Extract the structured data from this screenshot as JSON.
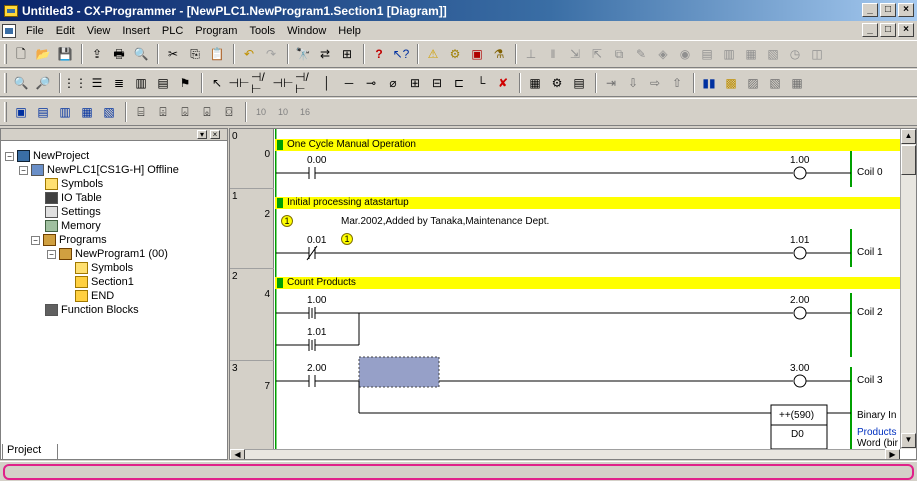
{
  "title": "Untitled3 - CX-Programmer - [NewPLC1.NewProgram1.Section1 [Diagram]]",
  "window_buttons": {
    "minimize": "_",
    "maximize": "□",
    "close": "×"
  },
  "menu": [
    "File",
    "Edit",
    "View",
    "Insert",
    "PLC",
    "Program",
    "Tools",
    "Window",
    "Help"
  ],
  "tree": {
    "project": "NewProject",
    "plc": "NewPLC1[CS1G-H] Offline",
    "symbols": "Symbols",
    "io_table": "IO Table",
    "settings": "Settings",
    "memory": "Memory",
    "programs": "Programs",
    "program1": "NewProgram1 (00)",
    "prog_symbols": "Symbols",
    "section1": "Section1",
    "end": "END",
    "function_blocks": "Function Blocks",
    "tab": "Project"
  },
  "rungs": [
    {
      "index": "0",
      "address": "0",
      "comment": "One Cycle Manual Operation",
      "contact": "0.00",
      "coil_addr": "1.00",
      "coil_name": "Coil 0"
    },
    {
      "index": "1",
      "address": "2",
      "comment": "Initial processing atastartup",
      "note_marker": "1",
      "note": "Mar.2002,Added by Tanaka,Maintenance Dept.",
      "contact": "0.01",
      "contact_marker": "1",
      "coil_addr": "1.01",
      "coil_name": "Coil 1"
    },
    {
      "index": "2",
      "address": "4",
      "comment": "Count Products",
      "contact": "1.00",
      "contact2": "1.01",
      "coil_addr": "2.00",
      "coil_name": "Coil 2"
    },
    {
      "index": "3",
      "address": "7",
      "contact": "2.00",
      "coil_addr": "3.00",
      "coil_name": "Coil 3",
      "instr": "++(590)",
      "instr_operand": "D0",
      "instr_desc1": "Binary In",
      "instr_desc2": "Products",
      "instr_desc3": "Word (bir"
    }
  ]
}
